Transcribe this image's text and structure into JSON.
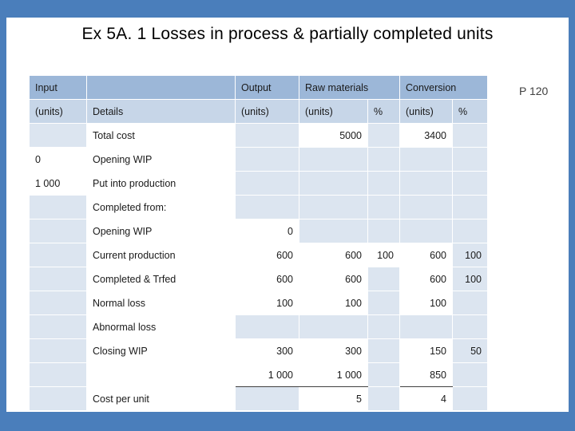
{
  "slide": {
    "title": "Ex 5A. 1 Losses in process & partially completed units",
    "page_ref": "P 120"
  },
  "table": {
    "header_row1": {
      "input": "Input",
      "details": "",
      "output": "Output",
      "raw_materials": "Raw materials",
      "conversion": "Conversion"
    },
    "header_row2": {
      "input_units": "(units)",
      "details": "Details",
      "output_units": "(units)",
      "rm_units": "(units)",
      "rm_pct": "%",
      "conv_units": "(units)",
      "conv_pct": "%"
    },
    "rows": [
      {
        "input": "",
        "details": "Total cost",
        "output": "",
        "rm": "5000",
        "rm_pct": "",
        "conv": "3400",
        "conv_pct": ""
      },
      {
        "input": "0",
        "details": "Opening WIP",
        "output": "",
        "rm": "",
        "rm_pct": "",
        "conv": "",
        "conv_pct": ""
      },
      {
        "input": "1 000",
        "details": "Put into production",
        "output": "",
        "rm": "",
        "rm_pct": "",
        "conv": "",
        "conv_pct": ""
      },
      {
        "input": "",
        "details": "Completed from:",
        "output": "",
        "rm": "",
        "rm_pct": "",
        "conv": "",
        "conv_pct": ""
      },
      {
        "input": "",
        "details": "Opening WIP",
        "output": "0",
        "rm": "",
        "rm_pct": "",
        "conv": "",
        "conv_pct": ""
      },
      {
        "input": "",
        "details": "Current production",
        "output": "600",
        "rm": "600",
        "rm_pct": "100",
        "conv": "600",
        "conv_pct": "100"
      },
      {
        "input": "",
        "details": "Completed & Trfed",
        "output": "600",
        "rm": "600",
        "rm_pct": "",
        "conv": "600",
        "conv_pct": "100"
      },
      {
        "input": "",
        "details": "Normal loss",
        "output": "100",
        "rm": "100",
        "rm_pct": "",
        "conv": "100",
        "conv_pct": ""
      },
      {
        "input": "",
        "details": "Abnormal loss",
        "output": "",
        "rm": "",
        "rm_pct": "",
        "conv": "",
        "conv_pct": ""
      },
      {
        "input": "",
        "details": "Closing WIP",
        "output": "300",
        "rm": "300",
        "rm_pct": "",
        "conv": "150",
        "conv_pct": "50"
      },
      {
        "input": "",
        "details": "",
        "output": "1 000",
        "rm": "1 000",
        "rm_pct": "",
        "conv": "850",
        "conv_pct": ""
      },
      {
        "input": "",
        "details": "Cost per unit",
        "output": "",
        "rm": "5",
        "rm_pct": "",
        "conv": "4",
        "conv_pct": ""
      }
    ]
  },
  "colors": {
    "background": "#4a7ebb",
    "header_fill": "#9cb7d8",
    "header_fill_light": "#c7d6e8",
    "cell_fill": "#dce5f0",
    "panel": "#ffffff"
  }
}
